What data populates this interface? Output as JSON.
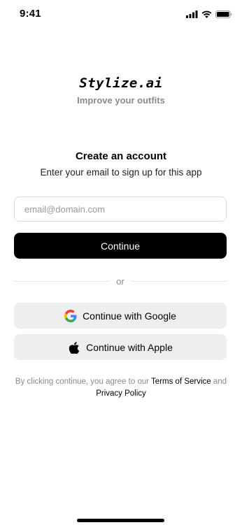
{
  "status_bar": {
    "time": "9:41"
  },
  "brand": {
    "title": "Stylize.ai",
    "tagline": "Improve your outfits"
  },
  "signup": {
    "title": "Create an account",
    "subtitle": "Enter your email to sign up for this app",
    "email_placeholder": "email@domain.com",
    "continue_label": "Continue",
    "divider_text": "or",
    "google_label": "Continue with Google",
    "apple_label": "Continue with Apple"
  },
  "legal": {
    "prefix": "By clicking continue, you agree to our ",
    "terms": "Terms of Service",
    "middle": " and ",
    "privacy": "Privacy Policy"
  },
  "icons": {
    "status": [
      "signal-icon",
      "wifi-icon",
      "battery-icon"
    ],
    "google": "google-icon",
    "apple": "apple-icon"
  },
  "colors": {
    "primary": "#000000",
    "secondary_button": "#eeeeee",
    "muted_text": "#8a8a8a"
  }
}
